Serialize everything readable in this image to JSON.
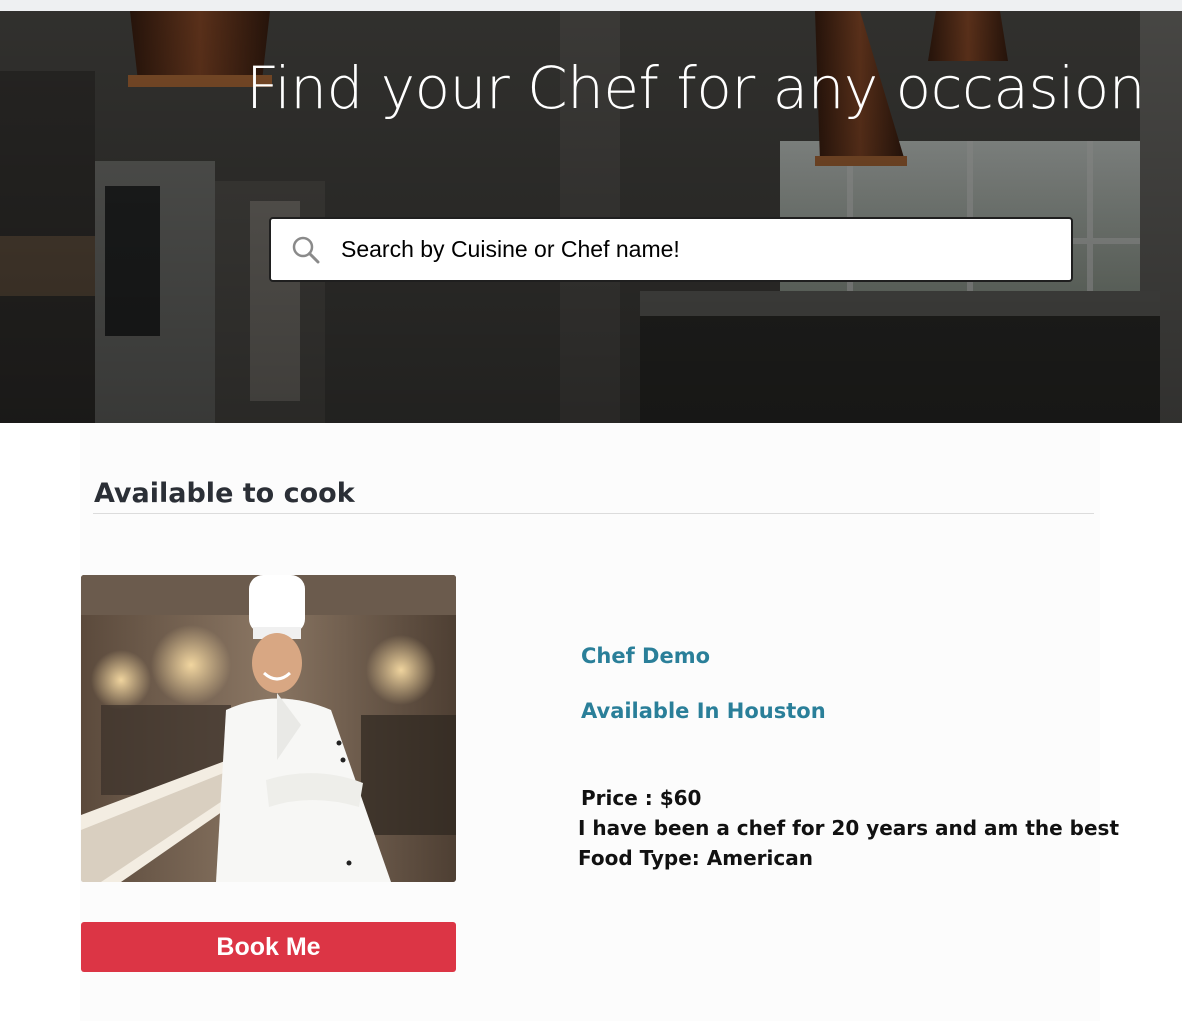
{
  "hero": {
    "title": "Find your Chef for any occasion"
  },
  "search": {
    "placeholder": "Search by Cuisine or Chef name!",
    "icon": "search-icon"
  },
  "section": {
    "heading": "Available to cook"
  },
  "chef": {
    "name": "Chef Demo",
    "location": "Available In Houston",
    "price": "Price : $60",
    "bio": "I have been a chef for 20 years and am the best",
    "food_type": "Food Type: American",
    "book_label": "Book Me"
  },
  "colors": {
    "accent_text": "#2a7f99",
    "book_button": "#dc3545",
    "heading": "#2b2f36"
  }
}
